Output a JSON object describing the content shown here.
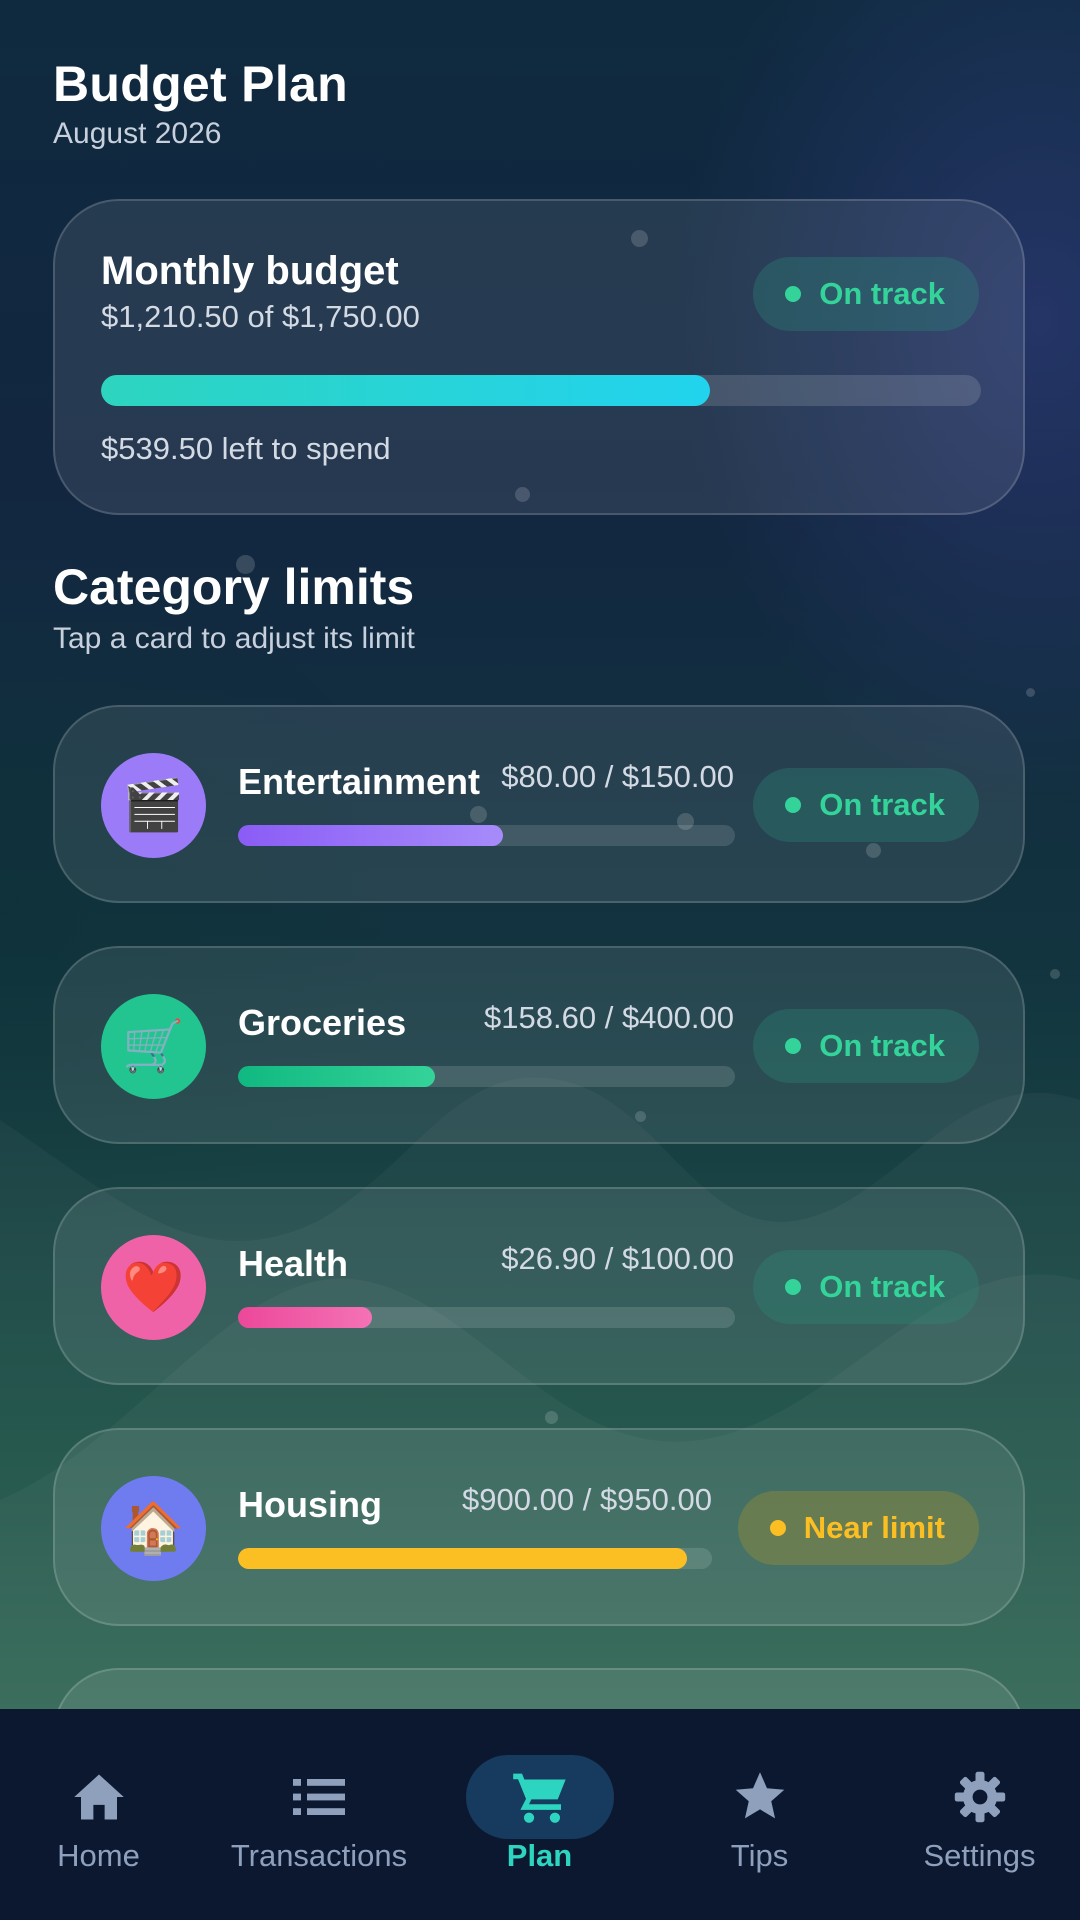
{
  "header": {
    "title": "Budget Plan",
    "subtitle": "August 2026"
  },
  "summary": {
    "title": "Monthly budget",
    "amount_text": "$1,210.50 of $1,750.00",
    "progress": 0.692,
    "left_text": "$539.50 left to spend",
    "badge": "On track"
  },
  "section": {
    "title": "Category limits",
    "subtitle": "Tap a card to adjust its limit"
  },
  "categories": [
    {
      "name": "Entertainment",
      "icon": "clapper-board-icon",
      "glyph": "🎬",
      "values_text": "$80.00 / $150.00",
      "progress": 0.533,
      "badge": "On track",
      "status": "ok",
      "color_from": "#8b5cf6",
      "color_to": "#a78bfa",
      "icon_bg": "#9b7bf7"
    },
    {
      "name": "Groceries",
      "icon": "shopping-cart-icon",
      "glyph": "🛒",
      "values_text": "$158.60 / $400.00",
      "progress": 0.397,
      "badge": "On track",
      "status": "ok",
      "color_from": "#10b981",
      "color_to": "#34d399",
      "icon_bg": "#22c58f"
    },
    {
      "name": "Health",
      "icon": "heart-icon",
      "glyph": "❤️",
      "values_text": "$26.90 / $100.00",
      "progress": 0.269,
      "badge": "On track",
      "status": "ok",
      "color_from": "#ec4899",
      "color_to": "#f472b6",
      "icon_bg": "#f062a8"
    },
    {
      "name": "Housing",
      "icon": "house-icon",
      "glyph": "🏠",
      "values_text": "$900.00 / $950.00",
      "progress": 0.947,
      "badge": "Near limit",
      "status": "warn",
      "color_from": "#fbbf24",
      "color_to": "#fbbf24",
      "icon_bg": "#6f7cf0"
    }
  ],
  "nav": [
    {
      "label": "Home",
      "icon": "home-icon"
    },
    {
      "label": "Transactions",
      "icon": "list-icon"
    },
    {
      "label": "Plan",
      "icon": "cart-icon",
      "active": true
    },
    {
      "label": "Tips",
      "icon": "star-icon"
    },
    {
      "label": "Settings",
      "icon": "gear-icon"
    }
  ],
  "colors": {
    "accent": "#2dd4bf",
    "ok": "#34d399",
    "warn": "#fbbf24",
    "nav_bg": "#0b1830"
  }
}
